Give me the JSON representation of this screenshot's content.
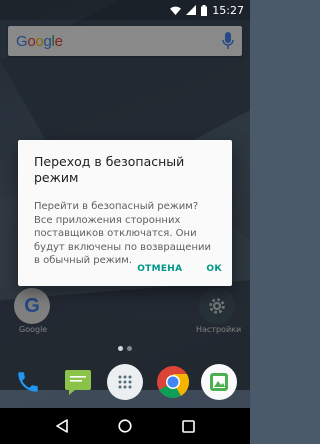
{
  "status_bar": {
    "time": "15:27"
  },
  "search": {
    "logo": "Google"
  },
  "home": {
    "apps": [
      {
        "label": "Google",
        "icon": "google-app-icon"
      },
      {
        "label": "Настройки",
        "icon": "settings-app-icon"
      }
    ],
    "dock": [
      "phone-icon",
      "messages-icon",
      "all-apps-icon",
      "chrome-icon",
      "camera-icon"
    ]
  },
  "dialog": {
    "title": "Переход в безопасный режим",
    "message": "Перейти в безопасный режим? Все приложения сторонних поставщиков отключатся. Они будут включены по возвращении в обычный режим.",
    "cancel_label": "ОТМЕНА",
    "ok_label": "ОК",
    "accent_color": "#009688"
  },
  "nav": {
    "back": "back-icon",
    "home": "home-icon",
    "recents": "recents-icon"
  }
}
